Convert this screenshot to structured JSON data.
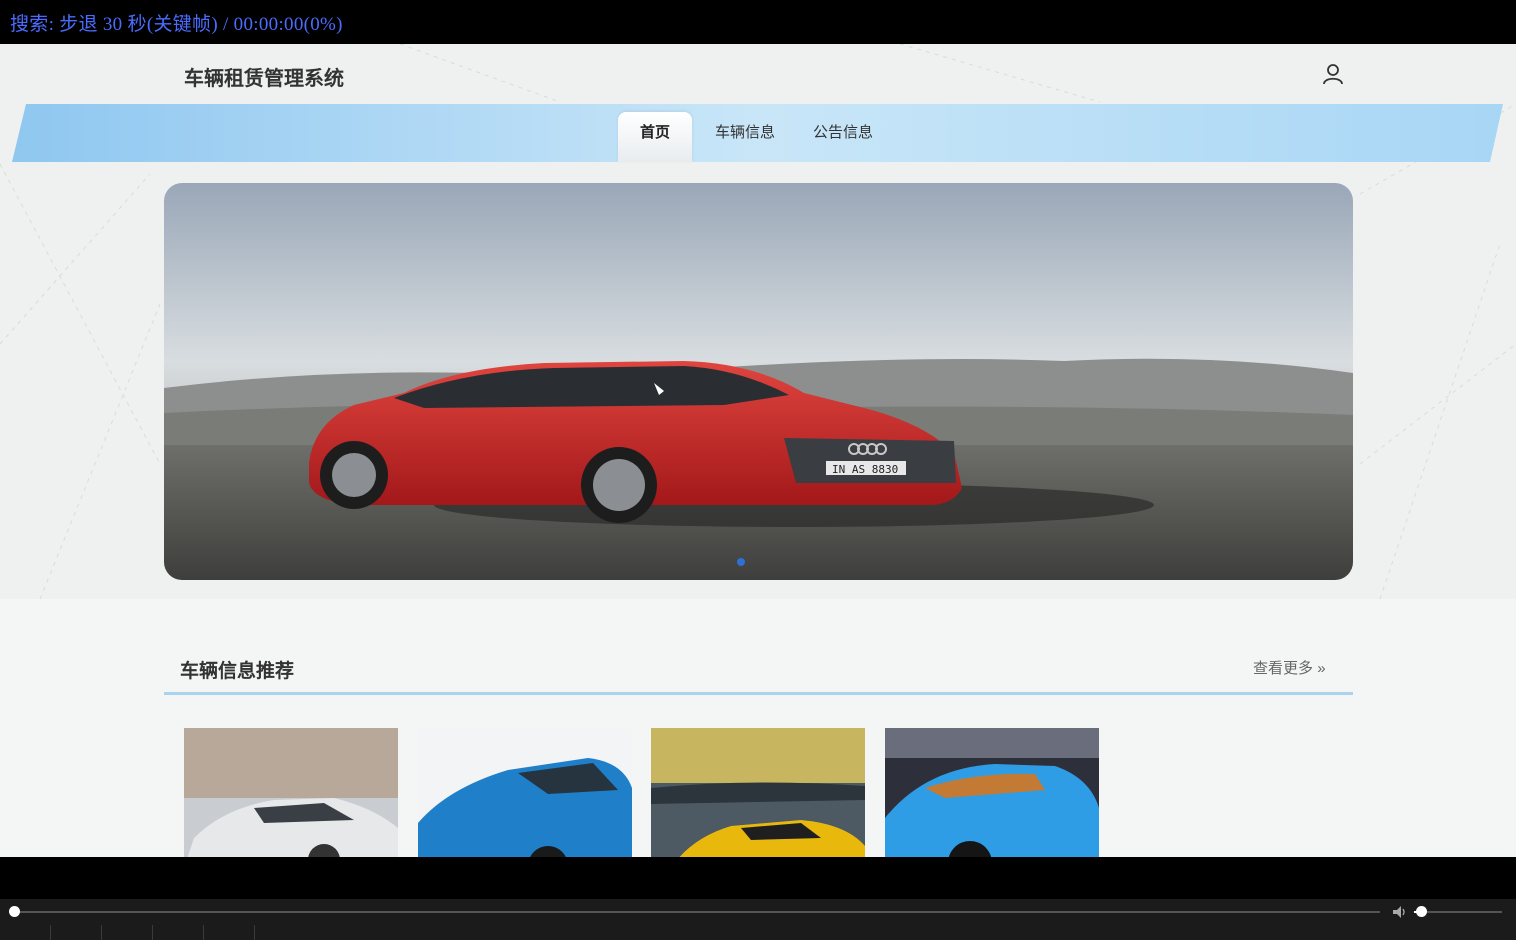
{
  "player": {
    "osd_text": "搜索: 步退 30 秒(关键帧) / 00:00:00(0%)",
    "progress_fraction": 0.0,
    "volume_fraction": 0.08
  },
  "site": {
    "title": "车辆租赁管理系统"
  },
  "nav": {
    "items": [
      {
        "label": "首页",
        "active": true
      },
      {
        "label": "车辆信息",
        "active": false
      },
      {
        "label": "公告信息",
        "active": false
      }
    ]
  },
  "banner": {
    "image": "red-audi-wagon",
    "plate": "IN AS 8830",
    "dot_color": "#2f6fd6"
  },
  "recommend": {
    "title": "车辆信息推荐",
    "more_label": "查看更多",
    "more_icon": "double-chevron-right-icon",
    "cards": [
      {
        "image": "silver-audi-r8"
      },
      {
        "image": "blue-hatchback"
      },
      {
        "image": "yellow-mclaren"
      },
      {
        "image": "blue-bugatti"
      }
    ]
  },
  "colors": {
    "accent_band": "#9fd0f2",
    "section_line": "#a9d3ef",
    "osd_text": "#4a6cff"
  }
}
